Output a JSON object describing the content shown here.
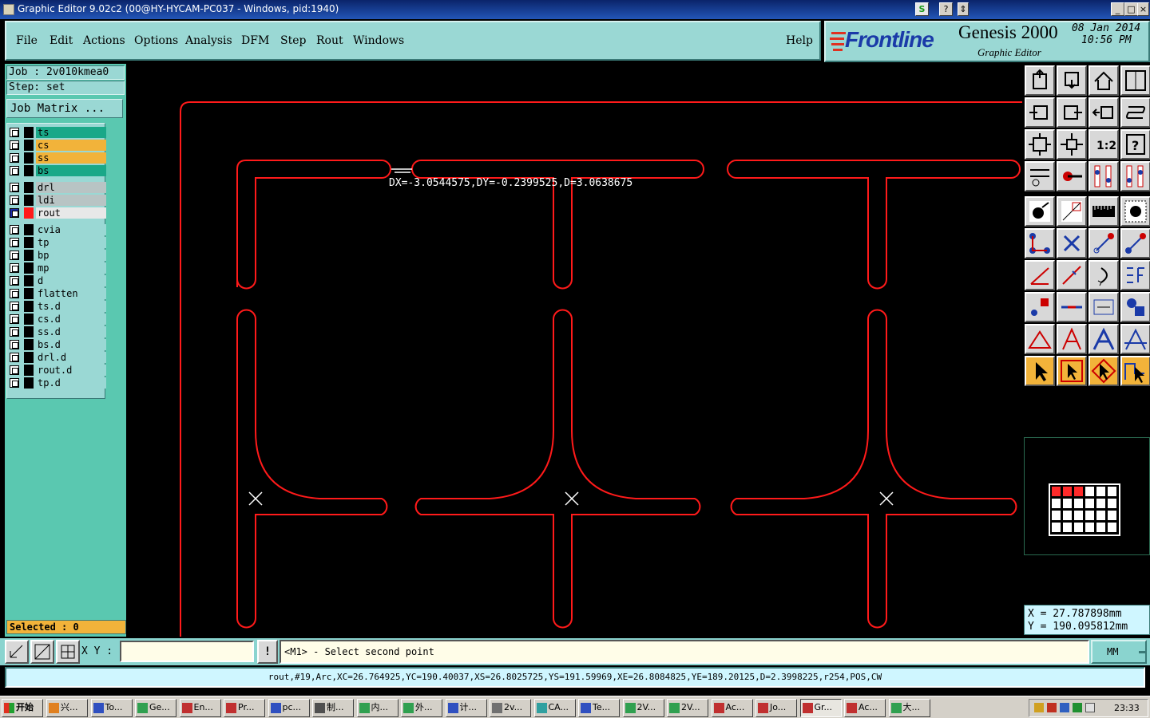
{
  "window": {
    "title": "Graphic Editor 9.02c2 (00@HY-HYCAM-PC037 - Windows, pid:1940)",
    "controls": [
      "_",
      "□",
      "×"
    ]
  },
  "menu": {
    "items": [
      "File",
      "Edit",
      "Actions",
      "Options",
      "Analysis",
      "DFM",
      "Step",
      "Rout",
      "Windows"
    ],
    "help": "Help"
  },
  "branding": {
    "logo": "Frontline",
    "product": "Genesis 2000",
    "subtitle": "Graphic Editor",
    "date": "08 Jan 2014",
    "time": "10:56 PM"
  },
  "job": {
    "job_label": "Job : 2v010kmea0",
    "step_label": "Step: set",
    "matrix_button": "Job Matrix ..."
  },
  "layers": [
    {
      "name": "ts",
      "color": "#1aa888"
    },
    {
      "name": "cs",
      "color": "#f2b33a"
    },
    {
      "name": "ss",
      "color": "#f2b33a"
    },
    {
      "name": "bs",
      "color": "#1aa888"
    },
    {
      "name": "drl",
      "color": "#b8c4c4"
    },
    {
      "name": "ldi",
      "color": "#b8c4c4"
    },
    {
      "name": "rout",
      "color": "#e8e8e8"
    },
    {
      "name": "cvia",
      "color": "#9ad8d4"
    },
    {
      "name": "tp",
      "color": "#9ad8d4"
    },
    {
      "name": "bp",
      "color": "#9ad8d4"
    },
    {
      "name": "mp",
      "color": "#9ad8d4"
    },
    {
      "name": "d",
      "color": "#9ad8d4"
    },
    {
      "name": "flatten",
      "color": "#9ad8d4"
    },
    {
      "name": "ts.d",
      "color": "#9ad8d4"
    },
    {
      "name": "cs.d",
      "color": "#9ad8d4"
    },
    {
      "name": "ss.d",
      "color": "#9ad8d4"
    },
    {
      "name": "bs.d",
      "color": "#9ad8d4"
    },
    {
      "name": "drl.d",
      "color": "#9ad8d4"
    },
    {
      "name": "rout.d",
      "color": "#9ad8d4"
    },
    {
      "name": "tp.d",
      "color": "#9ad8d4"
    }
  ],
  "selected": "Selected : 0",
  "canvas": {
    "measure": "DX=-3.0544575,DY=-0.2399525,D=3.0638675",
    "rout_color": "#ff1a1a"
  },
  "coords": {
    "x": "X  =  27.787898mm",
    "y": "Y  =  190.095812mm"
  },
  "bottom": {
    "xy_label": "X Y :",
    "xy_value": "",
    "prompt": "<M1> - Select second point",
    "units": "MM",
    "status": "rout,#19,Arc,XC=26.764925,YC=190.40037,XS=26.8025725,YS=191.59969,XE=26.8084825,YE=189.20125,D=2.3998225,r254,POS,CW"
  },
  "taskbar": {
    "start": "开始",
    "tasks": [
      "兴...",
      "To...",
      "Ge...",
      "En...",
      "Pr...",
      "pc...",
      "制...",
      "内...",
      "外...",
      "计...",
      "2v...",
      "CA...",
      "Te...",
      "2V...",
      "2V...",
      "Ac...",
      "Jo...",
      "Gr...",
      "Ac...",
      "大..."
    ],
    "clock": "23:33"
  }
}
